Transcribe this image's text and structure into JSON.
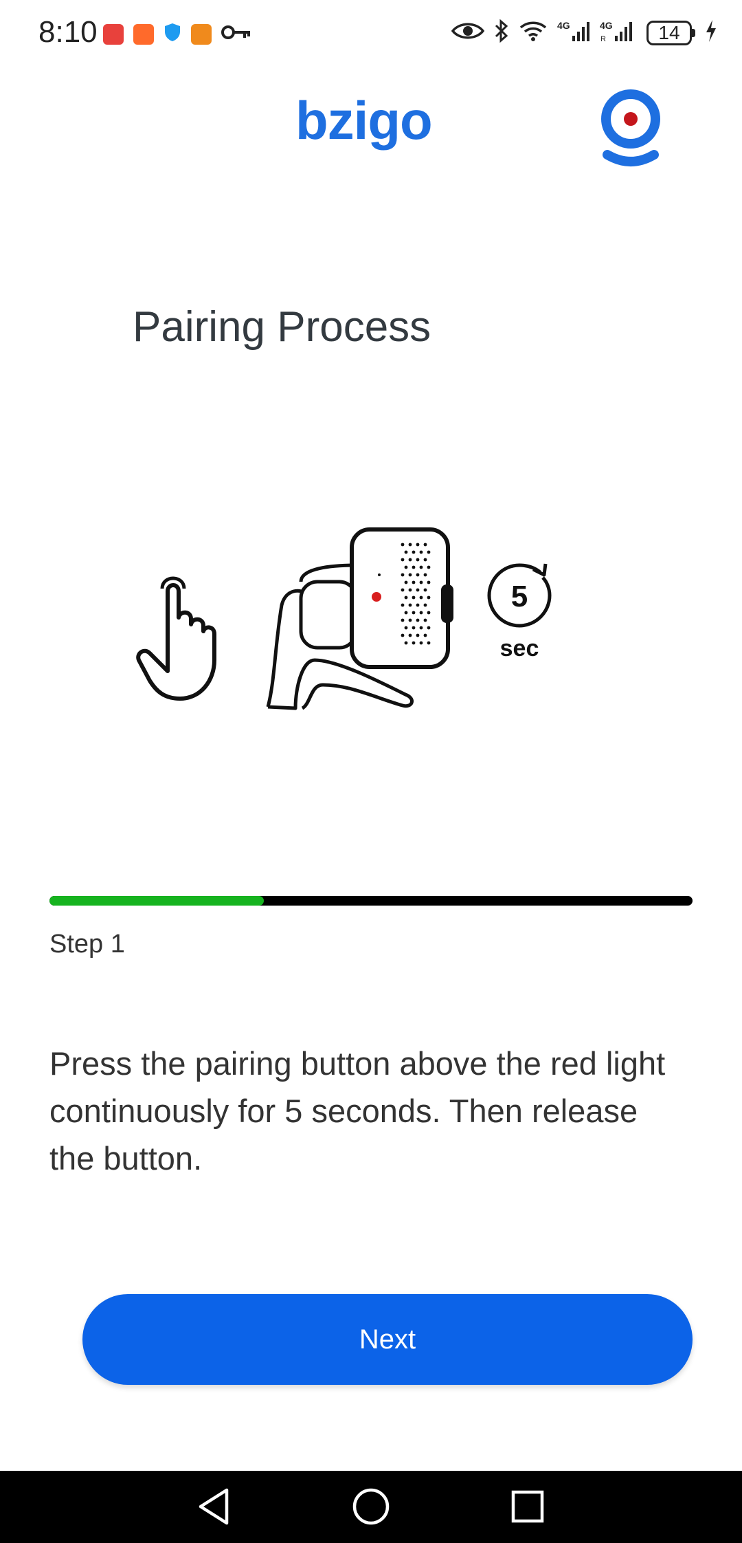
{
  "status_bar": {
    "time": "8:10",
    "battery": "14",
    "icons": [
      "huawei-app-icon",
      "taobao-icon",
      "shield-icon",
      "gift-icon",
      "key-icon",
      "eye-icon",
      "bluetooth-icon",
      "wifi-icon",
      "signal-4g-icon",
      "signal-4g-r-icon",
      "charging-icon"
    ]
  },
  "header": {
    "logo": "bzigo",
    "profile_icon": "profile-icon",
    "colors": {
      "brand": "#1e6fe0",
      "accent_red": "#c4161c"
    }
  },
  "page": {
    "title": "Pairing Process"
  },
  "illustration": {
    "icons": [
      "hand-press-icon",
      "camera-device-icon",
      "timer-icon"
    ],
    "timer_number": "5",
    "timer_unit": "sec"
  },
  "progress": {
    "fraction": 0.333,
    "fill_color": "#16b31f",
    "track_color": "#000000"
  },
  "step": {
    "label": "Step 1",
    "instructions": "Press the pairing button above the red light continuously for 5 seconds. Then release the button."
  },
  "actions": {
    "next_label": "Next",
    "button_color": "#0c63e8"
  },
  "nav_bar": {
    "icons": [
      "back-icon",
      "home-icon",
      "recents-icon"
    ]
  }
}
